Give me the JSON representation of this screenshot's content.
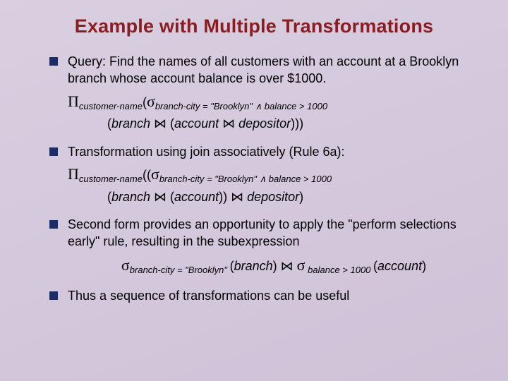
{
  "title": "Example with Multiple Transformations",
  "b1": {
    "lead": "Query:  Find the names of all customers with an account at a Brooklyn branch whose account balance is over $1000.",
    "f1_pi": "Π",
    "f1_sub1": "customer-name",
    "f1_open": "(",
    "f1_sigma": "σ",
    "f1_sub2": "branch-city = \"Brooklyn\" ",
    "f1_and": "∧",
    "f1_sub3": "  balance > 1000",
    "f2_open": "(",
    "f2_branch": "branch ",
    "f2_join1": "⋈",
    "f2_mid": " (",
    "f2_account": "account ",
    "f2_join2": "⋈",
    "f2_dep": " depositor",
    "f2_close": ")))"
  },
  "b2": {
    "lead": "Transformation using join associatively (Rule 6a):",
    "f1_pi": "Π",
    "f1_sub1": "customer-name",
    "f1_open": "((",
    "f1_sigma": "σ",
    "f1_sub2": "branch-city = \"Brooklyn\" ",
    "f1_and": "∧",
    "f1_sub3": "  balance > 1000",
    "f2_open": "(",
    "f2_branch": "branch ",
    "f2_join1": "⋈",
    "f2_mid": " (",
    "f2_account": "account",
    "f2_close1": ")) ",
    "f2_join2": "⋈",
    "f2_dep": " depositor",
    "f2_close2": ")"
  },
  "b3": {
    "lead": "Second form provides an opportunity to apply the \"perform selections early\" rule, resulting in the subexpression",
    "sigma1": "σ",
    "sub1": "branch-city = \"Brooklyn\" ",
    "open1": "(",
    "branch": "branch",
    "close1": ") ",
    "join": "⋈",
    "space": " ",
    "sigma2": "σ",
    "sub2": " balance > 1000 ",
    "open2": "(",
    "account": "account",
    "close2": ")"
  },
  "b4": {
    "lead": "Thus a sequence of transformations can be useful"
  }
}
